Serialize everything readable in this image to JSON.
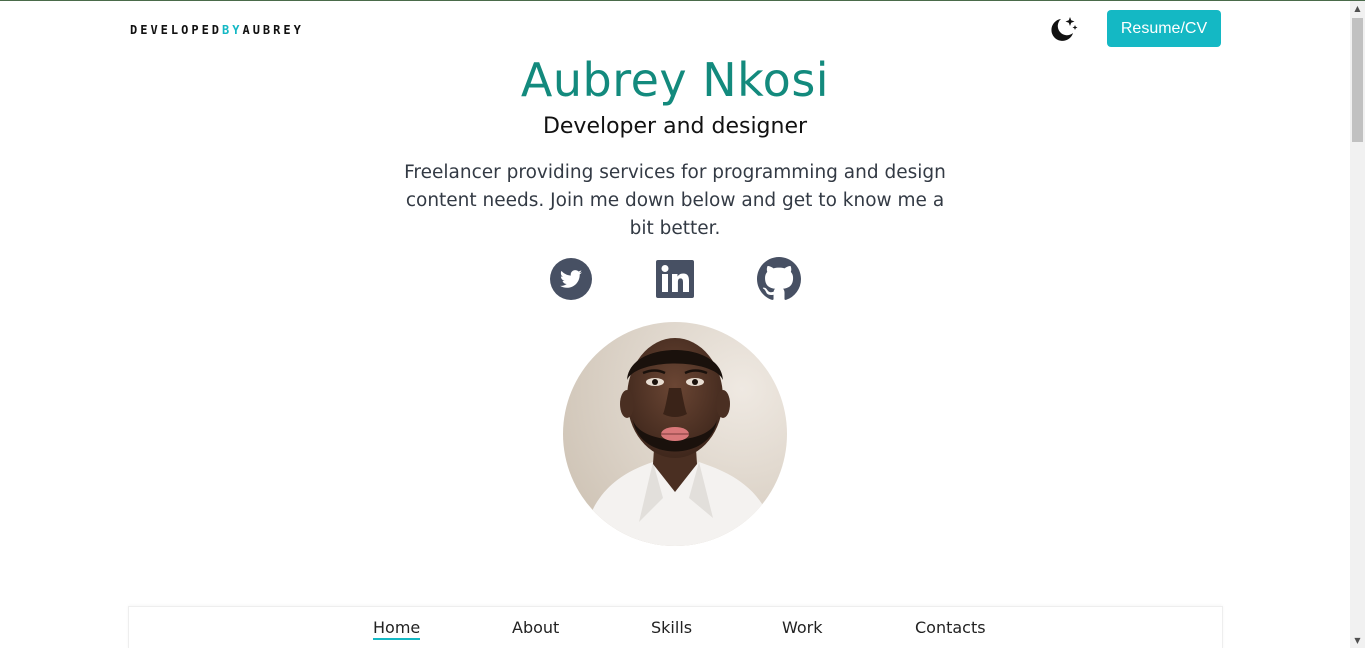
{
  "header": {
    "logo": {
      "part1": "DEVELOPED",
      "part2": "BY",
      "part3": "AUBREY"
    },
    "theme_toggle_icon": "moon-stars-icon",
    "resume_label": "Resume/CV"
  },
  "hero": {
    "name": "Aubrey Nkosi",
    "role": "Developer and designer",
    "bio": "Freelancer providing services for programming and design content needs. Join me down below and get to know me a bit better.",
    "socials": [
      {
        "icon": "twitter-icon"
      },
      {
        "icon": "linkedin-icon"
      },
      {
        "icon": "github-icon"
      }
    ],
    "avatar_icon": "profile-photo"
  },
  "nav": {
    "items": [
      {
        "label": "Home",
        "active": true
      },
      {
        "label": "About",
        "active": false
      },
      {
        "label": "Skills",
        "active": false
      },
      {
        "label": "Work",
        "active": false
      },
      {
        "label": "Contacts",
        "active": false
      }
    ]
  },
  "colors": {
    "accent": "#14b8c4",
    "name": "#138a7d",
    "icon": "#475063"
  }
}
